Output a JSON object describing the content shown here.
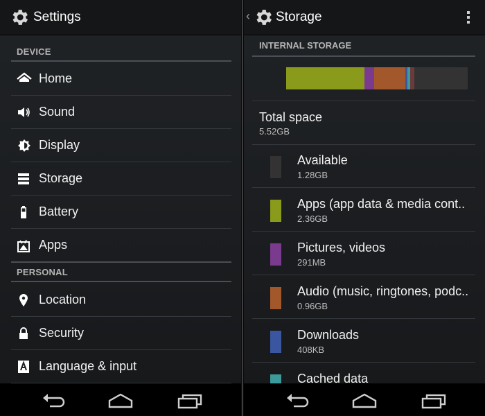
{
  "left": {
    "title": "Settings",
    "sections": {
      "device": "DEVICE",
      "personal": "PERSONAL"
    },
    "items": [
      {
        "label": "Home",
        "icon": "home-icon"
      },
      {
        "label": "Sound",
        "icon": "speaker-icon"
      },
      {
        "label": "Display",
        "icon": "brightness-icon"
      },
      {
        "label": "Storage",
        "icon": "storage-icon"
      },
      {
        "label": "Battery",
        "icon": "battery-icon"
      },
      {
        "label": "Apps",
        "icon": "apps-icon"
      },
      {
        "label": "Location",
        "icon": "location-pin-icon"
      },
      {
        "label": "Security",
        "icon": "lock-icon"
      },
      {
        "label": "Language & input",
        "icon": "keyboard-a-icon"
      }
    ]
  },
  "right": {
    "title": "Storage",
    "section": "INTERNAL STORAGE",
    "total": {
      "label": "Total space",
      "value": "5.52GB"
    },
    "rows": [
      {
        "label": "Available",
        "value": "1.28GB",
        "color": "#333333"
      },
      {
        "label": "Apps (app data & media cont..",
        "value": "2.36GB",
        "color": "#8a9a1b"
      },
      {
        "label": "Pictures, videos",
        "value": "291MB",
        "color": "#7a3b8e"
      },
      {
        "label": "Audio (music, ringtones, podc..",
        "value": "0.96GB",
        "color": "#a3582c"
      },
      {
        "label": "Downloads",
        "value": "408KB",
        "color": "#3b56a0"
      },
      {
        "label": "Cached data",
        "value": "",
        "color": "#3c9a9a"
      }
    ],
    "usage_bar": [
      {
        "name": "apps",
        "fraction": 0.43,
        "color": "#8a9a1b"
      },
      {
        "name": "pictures",
        "fraction": 0.053,
        "color": "#7a3b8e"
      },
      {
        "name": "audio",
        "fraction": 0.174,
        "color": "#a3582c"
      },
      {
        "name": "misc-1",
        "fraction": 0.01,
        "color": "#3b56a0"
      },
      {
        "name": "cached",
        "fraction": 0.018,
        "color": "#3c9a9a"
      },
      {
        "name": "misc-2",
        "fraction": 0.02,
        "color": "#6b3b3b"
      },
      {
        "name": "available",
        "fraction": 0.295,
        "color": "#333333"
      }
    ]
  },
  "nav": {
    "buttons": [
      "back-icon",
      "home-icon",
      "recent-apps-icon"
    ]
  }
}
